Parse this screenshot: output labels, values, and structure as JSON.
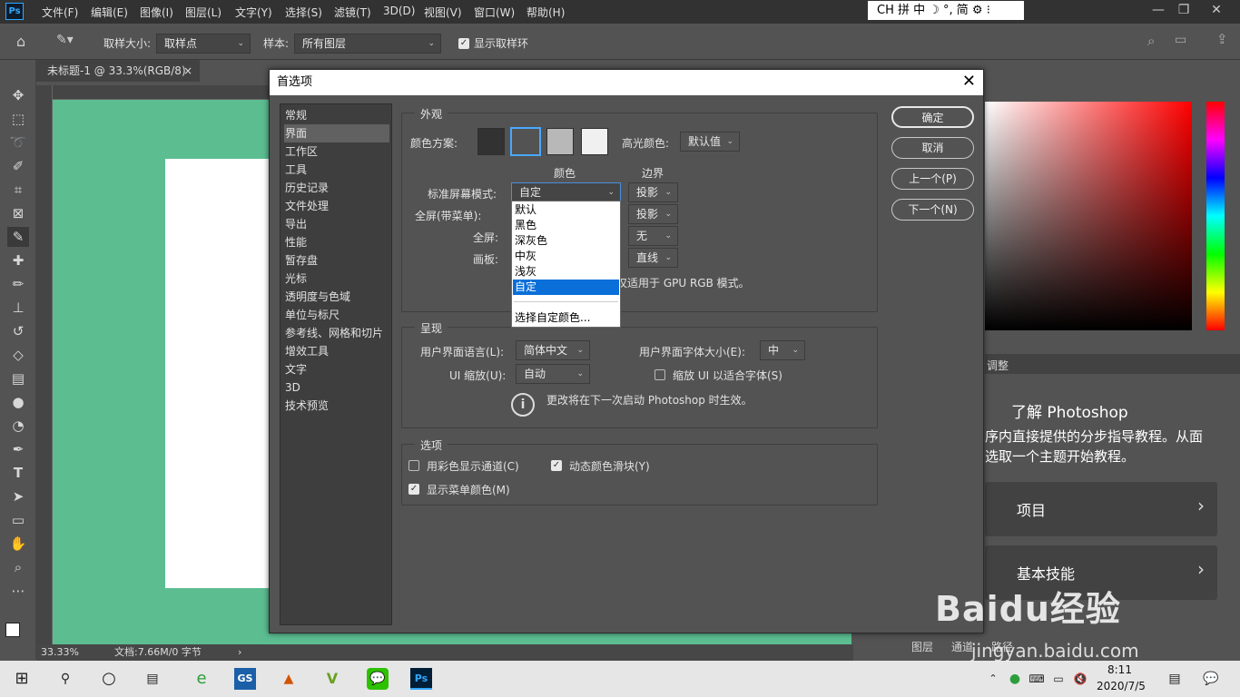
{
  "app": {
    "logo": "Ps"
  },
  "menubar": [
    "文件(F)",
    "编辑(E)",
    "图像(I)",
    "图层(L)",
    "文字(Y)",
    "选择(S)",
    "滤镜(T)",
    "3D(D)",
    "视图(V)",
    "窗口(W)",
    "帮助(H)"
  ],
  "ime": {
    "text": "CH 拼 中 ☽ °, 简 ⚙ ⁝"
  },
  "options": {
    "sample_size_label": "取样大小:",
    "sample_size_value": "取样点",
    "sample_label": "样本:",
    "sample_value": "所有图层",
    "show_ring_label": "显示取样环"
  },
  "document": {
    "tab_title": "未标题-1 @ 33.3%(RGB/8)",
    "tab_close": "×",
    "zoom": "33.33%",
    "doc_info": "文档:7.66M/0 字节"
  },
  "panels": {
    "adjust_tab": "调整",
    "learn_title": "了解 Photoshop",
    "learn_desc": "序内直接提供的分步指导教程。从面选取一个主题开始教程。",
    "card_projects": "项目",
    "card_basic": "基本技能",
    "tab_layers": "图层",
    "tab_channels": "通道",
    "tab_paths": "路径"
  },
  "dialog": {
    "title": "首选项",
    "nav": [
      "常规",
      "界面",
      "工作区",
      "工具",
      "历史记录",
      "文件处理",
      "导出",
      "性能",
      "暂存盘",
      "光标",
      "透明度与色域",
      "单位与标尺",
      "参考线、网格和切片",
      "增效工具",
      "文字",
      "3D",
      "技术预览"
    ],
    "nav_active": 1,
    "appearance": {
      "title": "外观",
      "color_scheme_label": "颜色方案:",
      "highlight_label": "高光颜色:",
      "highlight_value": "默认值",
      "col_color": "颜色",
      "col_border": "边界",
      "std_mode_label": "标准屏幕模式:",
      "std_mode_value": "自定",
      "full_menu_label": "全屏(带菜单):",
      "full_label": "全屏:",
      "artboard_label": "画板:",
      "border_std": "投影",
      "border_full_menu": "投影",
      "border_full": "无",
      "border_artboard": "直线",
      "note": "仅适用于 GPU RGB 模式。"
    },
    "dropdown_options": [
      "默认",
      "黑色",
      "深灰色",
      "中灰",
      "浅灰",
      "自定",
      "",
      "选择自定颜色..."
    ],
    "dropdown_selected": 5,
    "presentation": {
      "title": "呈现",
      "lang_label": "用户界面语言(L):",
      "lang_value": "简体中文",
      "font_size_label": "用户界面字体大小(E):",
      "font_size_value": "中",
      "scale_label": "UI 缩放(U):",
      "scale_value": "自动",
      "scale_fit_label": "缩放 UI 以适合字体(S)",
      "restart_note": "更改将在下一次启动 Photoshop 时生效。"
    },
    "options": {
      "title": "选项",
      "color_channels_label": "用彩色显示通道(C)",
      "color_channels_checked": false,
      "dynamic_sliders_label": "动态颜色滑块(Y)",
      "dynamic_sliders_checked": true,
      "menu_colors_label": "显示菜单颜色(M)",
      "menu_colors_checked": true
    },
    "buttons": {
      "ok": "确定",
      "cancel": "取消",
      "prev": "上一个(P)",
      "next": "下一个(N)"
    }
  },
  "taskbar": {
    "time": "8:11",
    "date": "2020/7/5"
  },
  "watermark": {
    "brand": "Baidu经验",
    "url": "jingyan.baidu.com"
  }
}
